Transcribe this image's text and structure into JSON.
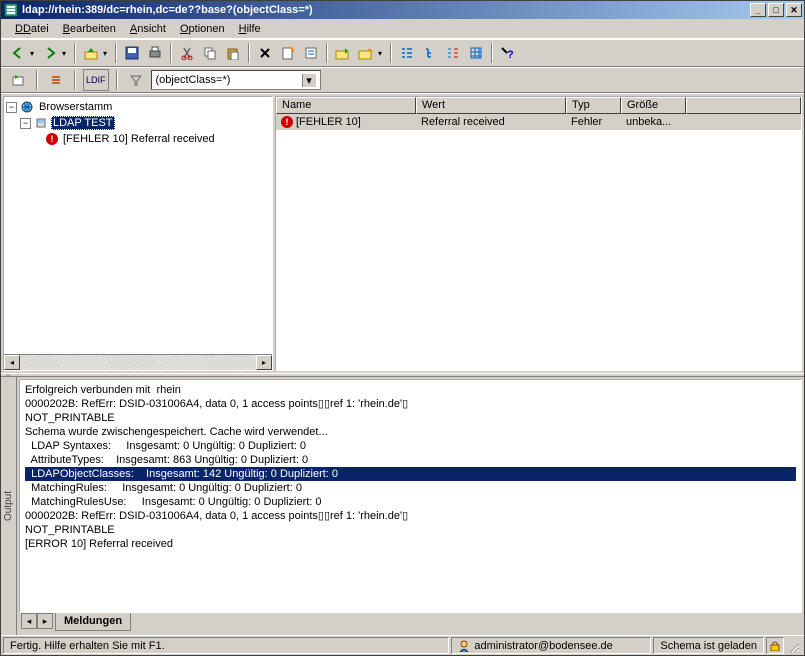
{
  "window": {
    "title": "ldap://rhein:389/dc=rhein,dc=de??base?(objectClass=*)"
  },
  "menu": {
    "datei": "Datei",
    "bearbeiten": "Bearbeiten",
    "ansicht": "Ansicht",
    "optionen": "Optionen",
    "hilfe": "Hilfe"
  },
  "filter": {
    "ldif_label": "LDIF",
    "combo_value": "(objectClass=*)"
  },
  "tree": {
    "root": "Browserstamm",
    "node1": "LDAP TEST",
    "node2": "[FEHLER 10] Referral received"
  },
  "columns": {
    "name": "Name",
    "wert": "Wert",
    "typ": "Typ",
    "groesse": "Größe"
  },
  "row": {
    "name": "[FEHLER 10]",
    "wert": "Referral received",
    "typ": "Fehler",
    "groesse": "unbeka..."
  },
  "output": {
    "tab_label": "Output",
    "lines": {
      "l0": "Erfolgreich verbunden mit  rhein",
      "l1": "0000202B: RefErr: DSID-031006A4, data 0, 1 access points▯▯ref 1: 'rhein.de'▯",
      "l2": "NOT_PRINTABLE",
      "l3": "Schema wurde zwischengespeichert. Cache wird verwendet...",
      "l4": "  LDAP Syntaxes:     Insgesamt: 0 Ungültig: 0 Dupliziert: 0",
      "l5": "  AttributeTypes:    Insgesamt: 863 Ungültig: 0 Dupliziert: 0",
      "l6": "  LDAPObjectClasses:    Insgesamt: 142 Ungültig: 0 Dupliziert: 0",
      "l7": "  MatchingRules:     Insgesamt: 0 Ungültig: 0 Dupliziert: 0",
      "l8": "  MatchingRulesUse:     Insgesamt: 0 Ungültig: 0 Dupliziert: 0",
      "l9": "0000202B: RefErr: DSID-031006A4, data 0, 1 access points▯▯ref 1: 'rhein.de'▯",
      "l10": "NOT_PRINTABLE",
      "l11": "[ERROR 10] Referral received"
    },
    "tab_meldungen": "Meldungen"
  },
  "status": {
    "help": "Fertig. Hilfe erhalten Sie mit F1.",
    "user": "administrator@bodensee.de",
    "schema": "Schema ist geladen"
  }
}
